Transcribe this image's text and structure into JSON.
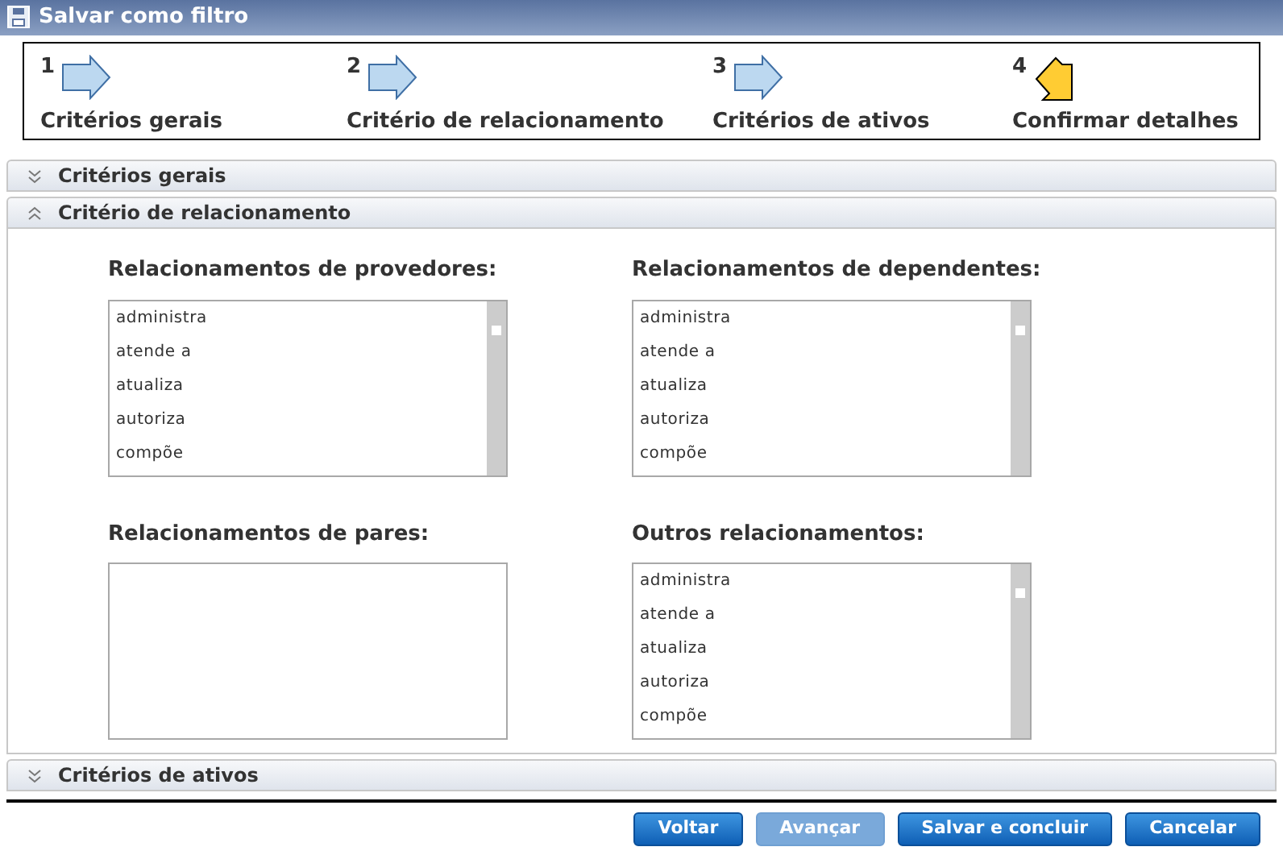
{
  "window": {
    "title": "Salvar como filtro"
  },
  "steps": [
    {
      "number": "1",
      "label": "Critérios gerais",
      "selected": false
    },
    {
      "number": "2",
      "label": "Critério de relacionamento",
      "selected": false
    },
    {
      "number": "3",
      "label": "Critérios de ativos",
      "selected": false
    },
    {
      "number": "4",
      "label": "Confirmar detalhes",
      "selected": true
    }
  ],
  "sections": [
    {
      "title": "Critérios gerais",
      "expanded": false
    },
    {
      "title": "Critério de relacionamento",
      "expanded": true,
      "lists": [
        {
          "label": "Relacionamentos de provedores:",
          "items": [
            "administra",
            "atende a",
            "atualiza",
            "autoriza",
            "compõe"
          ]
        },
        {
          "label": "Relacionamentos de dependentes:",
          "items": [
            "administra",
            "atende a",
            "atualiza",
            "autoriza",
            "compõe"
          ]
        },
        {
          "label": "Relacionamentos de pares:"
        },
        {
          "label": "Outros relacionamentos:",
          "items": [
            "administra",
            "atende a",
            "atualiza",
            "autoriza",
            "compõe"
          ]
        }
      ]
    },
    {
      "title": "Critérios de ativos",
      "expanded": false
    }
  ],
  "buttons": [
    {
      "label": "Voltar",
      "disabled": false
    },
    {
      "label": "Avançar",
      "disabled": true
    },
    {
      "label": "Salvar e concluir",
      "disabled": false
    },
    {
      "label": "Cancelar",
      "disabled": false
    }
  ]
}
